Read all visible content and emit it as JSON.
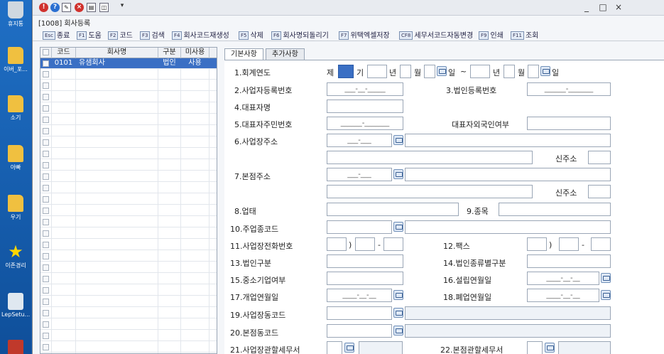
{
  "desktop": {
    "icons": [
      {
        "label": "휴지통",
        "icon": "recycle-bin-icon"
      },
      {
        "label": "이버_포...",
        "icon": "folder-icon"
      },
      {
        "label": "소기",
        "icon": "folder-icon"
      },
      {
        "label": "아빠",
        "icon": "folder-icon"
      },
      {
        "label": "우기",
        "icon": "folder-icon"
      },
      {
        "label": "이존경리",
        "icon": "star-icon"
      },
      {
        "label": "LepSetu...",
        "icon": "setup-icon"
      }
    ]
  },
  "window": {
    "form_title": "[1008] 회사등록",
    "menu_arrow": "▾",
    "controls": {
      "minimize": "_",
      "maximize": "□",
      "close": "×"
    }
  },
  "toolbar": {
    "buttons": [
      {
        "key": "Esc",
        "label": "종료"
      },
      {
        "key": "F1",
        "label": "도움"
      },
      {
        "key": "F2",
        "label": "코드"
      },
      {
        "key": "F3",
        "label": "검색"
      },
      {
        "key": "F4",
        "label": "회사코드재생성"
      },
      {
        "key": "F5",
        "label": "삭제"
      },
      {
        "key": "F6",
        "label": "회사명되돌리기"
      },
      {
        "key": "F7",
        "label": "위택엑셀저장"
      },
      {
        "key": "CF8",
        "label": "세무서코드자동변경"
      },
      {
        "key": "F9",
        "label": "인쇄"
      },
      {
        "key": "F11",
        "label": "조회"
      }
    ]
  },
  "grid": {
    "columns": [
      "코드",
      "회사명",
      "구분",
      "미사용"
    ],
    "rows": [
      {
        "code": "0101",
        "name": "유샘회사",
        "type": "법인",
        "unused": "사용",
        "selected": true
      }
    ],
    "empty_rows": 25
  },
  "tabs": [
    {
      "label": "기본사항",
      "active": true
    },
    {
      "label": "추가사항",
      "active": false
    }
  ],
  "form": {
    "fiscal_year": {
      "label": "1.회계연도",
      "prefix": "제",
      "unit_gi": "기",
      "unit_year": "년",
      "unit_month": "월",
      "unit_day": "일",
      "sep": "~"
    },
    "biz_reg_no": {
      "label": "2.사업자등록번호",
      "placeholder": "___-__-_____"
    },
    "corp_reg_no": {
      "label": "3.법인등록번호",
      "placeholder": "______-_______"
    },
    "ceo_name": {
      "label": "4.대표자명"
    },
    "ceo_rrn": {
      "label": "5.대표자주민번호",
      "placeholder": "______-_______"
    },
    "ceo_foreign": {
      "label": "대표자외국인여부"
    },
    "biz_address": {
      "label": "6.사업장주소",
      "zip_placeholder": "___-___",
      "new_addr": "신주소"
    },
    "hq_address": {
      "label": "7.본점주소",
      "zip_placeholder": "___-___",
      "new_addr": "신주소"
    },
    "business_type": {
      "label": "8.업태"
    },
    "business_item": {
      "label": "9.종목"
    },
    "main_industry": {
      "label": "10.주업종코드"
    },
    "biz_phone": {
      "label": "11.사업장전화번호",
      "sep1": ")",
      "sep2": "-"
    },
    "fax": {
      "label": "12.팩스",
      "sep1": ")",
      "sep2": "-"
    },
    "corp_type": {
      "label": "13.법인구분"
    },
    "corp_kind": {
      "label": "14.법인종류별구분"
    },
    "sme": {
      "label": "15.중소기업여부"
    },
    "founded": {
      "label": "16.설립연월일",
      "placeholder": "____-__-__"
    },
    "opened": {
      "label": "17.개업연월일",
      "placeholder": "____-__-__"
    },
    "closed": {
      "label": "18.폐업연월일",
      "placeholder": "____-__-__"
    },
    "biz_dong": {
      "label": "19.사업장동코드"
    },
    "hq_dong": {
      "label": "20.본점동코드"
    },
    "biz_tax_office": {
      "label": "21.사업장관할세무서"
    },
    "hq_tax_office": {
      "label": "22.본점관할세무서"
    }
  }
}
